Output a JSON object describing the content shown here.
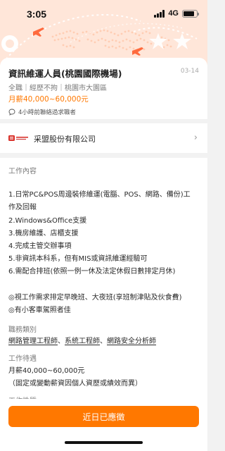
{
  "status_bar": {
    "time": "3:05",
    "network": "4G",
    "battery_level": 0.85
  },
  "job": {
    "title": "資訊維運人員(桃園國際機場)",
    "posted_date": "03-14",
    "meta": "全職｜經歷不拘｜桃園市大園區",
    "salary": "月薪40,000~60,000元",
    "contact_note": "4小時前聯絡過求職者"
  },
  "company": {
    "name": "采盟股份有限公司",
    "logo_icon": "company-logo"
  },
  "details": {
    "work_content_title": "工作內容",
    "work_content_lines": [
      "1.日常PC&POS周邊裝修維運(電腦、POS、網路、備份)工",
      "作及回報",
      "2.Windows&Office支援",
      "3.機房維護、店櫃支援",
      "4.完成主管交辦事項",
      "5.非資訊本科系，但有MIS或資訊維運經驗可",
      "6.需配合排班(依照一例一休及法定休假日數排定月休)"
    ],
    "notes": [
      "◎視工作需求排定早晚班、大夜班(享班制津貼及伙食費)",
      "◎有小客車駕照者佳"
    ],
    "category_title": "職務類別",
    "categories": [
      "網路管理工程師",
      "系統工程師",
      "網路安全分析師"
    ],
    "category_sep": "、",
    "treatment_title": "工作待遇",
    "treatment_salary": "月薪40,000~60,000元",
    "treatment_note": "（固定或變動薪資因個人資歷或績效而異）",
    "nature_title": "工作性質"
  },
  "actions": {
    "apply_label": "近日已應徵"
  },
  "colors": {
    "accent": "#ff7800",
    "hero_bg": "#ffe6d9",
    "text_primary": "#292929",
    "text_secondary": "#7b7b7b"
  }
}
